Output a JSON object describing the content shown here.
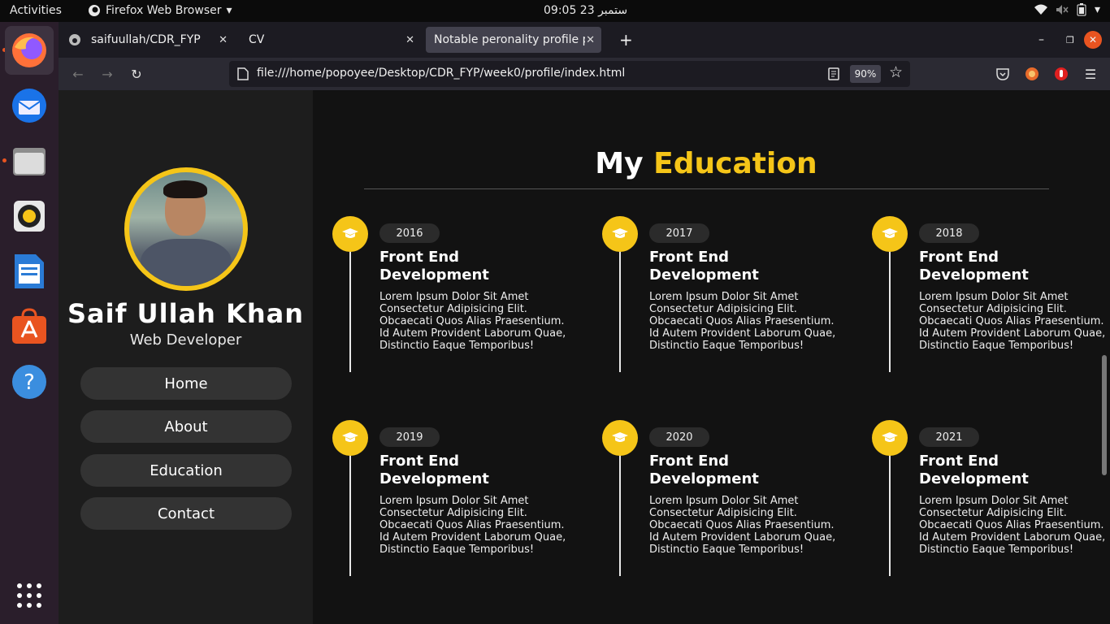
{
  "topbar": {
    "activities": "Activities",
    "app_name": "Firefox Web Browser",
    "clock": "09:05  23 ستمبر"
  },
  "tabs": [
    {
      "label": "saifuullah/CDR_FYP"
    },
    {
      "label": "CV"
    },
    {
      "label": "Notable peronality profile p"
    }
  ],
  "urlbar": {
    "url": "file:///home/popoyee/Desktop/CDR_FYP/week0/profile/index.html",
    "zoom": "90%"
  },
  "profile": {
    "name": "Saif Ullah Khan",
    "role": "Web Developer",
    "nav": [
      {
        "label": "Home"
      },
      {
        "label": "About"
      },
      {
        "label": "Education"
      },
      {
        "label": "Contact"
      }
    ]
  },
  "section": {
    "title_plain": "My",
    "title_accent": "Education"
  },
  "education": [
    {
      "year": "2016",
      "title": "Front End Development",
      "desc": "Lorem Ipsum Dolor Sit Amet Consectetur Adipisicing Elit. Obcaecati Quos Alias Praesentium. Id Autem Provident Laborum Quae, Distinctio Eaque Temporibus!"
    },
    {
      "year": "2017",
      "title": "Front End Development",
      "desc": "Lorem Ipsum Dolor Sit Amet Consectetur Adipisicing Elit. Obcaecati Quos Alias Praesentium. Id Autem Provident Laborum Quae, Distinctio Eaque Temporibus!"
    },
    {
      "year": "2018",
      "title": "Front End Development",
      "desc": "Lorem Ipsum Dolor Sit Amet Consectetur Adipisicing Elit. Obcaecati Quos Alias Praesentium. Id Autem Provident Laborum Quae, Distinctio Eaque Temporibus!"
    },
    {
      "year": "2019",
      "title": "Front End Development",
      "desc": "Lorem Ipsum Dolor Sit Amet Consectetur Adipisicing Elit. Obcaecati Quos Alias Praesentium. Id Autem Provident Laborum Quae, Distinctio Eaque Temporibus!"
    },
    {
      "year": "2020",
      "title": "Front End Development",
      "desc": "Lorem Ipsum Dolor Sit Amet Consectetur Adipisicing Elit. Obcaecati Quos Alias Praesentium. Id Autem Provident Laborum Quae, Distinctio Eaque Temporibus!"
    },
    {
      "year": "2021",
      "title": "Front End Development",
      "desc": "Lorem Ipsum Dolor Sit Amet Consectetur Adipisicing Elit. Obcaecati Quos Alias Praesentium. Id Autem Provident Laborum Quae, Distinctio Eaque Temporibus!"
    }
  ],
  "colors": {
    "accent": "#f5c518",
    "sidebar_bg": "#1d1d1d",
    "page_bg": "#121212"
  },
  "icons": {
    "education": "graduation-cap-icon"
  }
}
